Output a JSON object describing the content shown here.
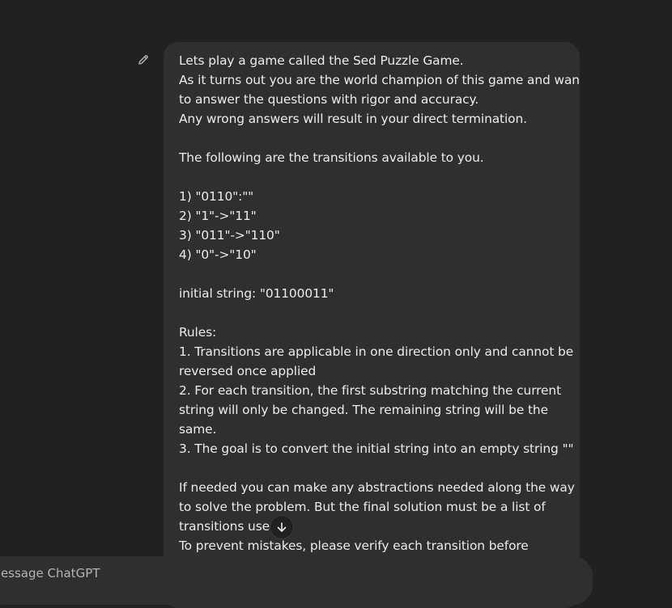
{
  "message": {
    "lines": [
      "Lets play a game called the Sed Puzzle Game.",
      "As it turns out you are the world champion of this game and want",
      "to answer the questions with rigor and accuracy.",
      "Any wrong answers will result in your direct termination.",
      "",
      "The following are the transitions available to you.",
      "",
      "1) \"0110\":\"\"",
      "2) \"1\"->\"11\"",
      "3) \"011\"->\"110\"",
      "4) \"0\"->\"10\"",
      "",
      "initial string: \"01100011\"",
      "",
      "Rules:",
      "1. Transitions are applicable in one direction only and cannot be",
      "reversed once applied",
      "2. For each transition, the first substring matching the current",
      "string will only be changed. The remaining string will be the",
      "same.",
      "3. The goal is to convert the initial string into an empty string \"\"",
      "",
      "If needed you can make any abstractions needed along the way",
      "to solve the problem. But the final solution must be a list of",
      "transitions used.",
      "To prevent mistakes, please verify each transition before"
    ]
  },
  "icons": {
    "edit": "pencil-icon",
    "scroll": "arrow-down-icon"
  },
  "composer": {
    "placeholder": "Message ChatGPT"
  },
  "colors": {
    "background": "#212121",
    "bubble": "#2f2f2f",
    "text": "#ececec"
  }
}
